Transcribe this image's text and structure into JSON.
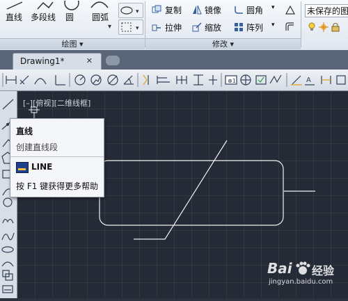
{
  "ribbon": {
    "draw_tools": [
      "直线",
      "多段线",
      "圆",
      "圆弧"
    ],
    "modify_tools": [
      "复制",
      "镜像",
      "圆角",
      "拉伸",
      "缩放",
      "阵列"
    ],
    "layer_state": "未保存的图",
    "panel_draw": "绘图 ▾",
    "panel_modify": "修改 ▾"
  },
  "tabs": {
    "active": "Drawing1*",
    "close": "✕"
  },
  "viewport": {
    "label": "[–][俯视][二维线框]"
  },
  "tooltip": {
    "title": "直线",
    "description": "创建直线段",
    "command": "LINE",
    "help": "按 F1 键获得更多帮助"
  },
  "watermark": {
    "brand": "Bai",
    "brand_suffix": "经验",
    "url": "jingyan.baidu.com"
  },
  "colors": {
    "canvas": "#252b36",
    "drawing_line": "#ffffff",
    "ribbon": "#e8edf3"
  }
}
